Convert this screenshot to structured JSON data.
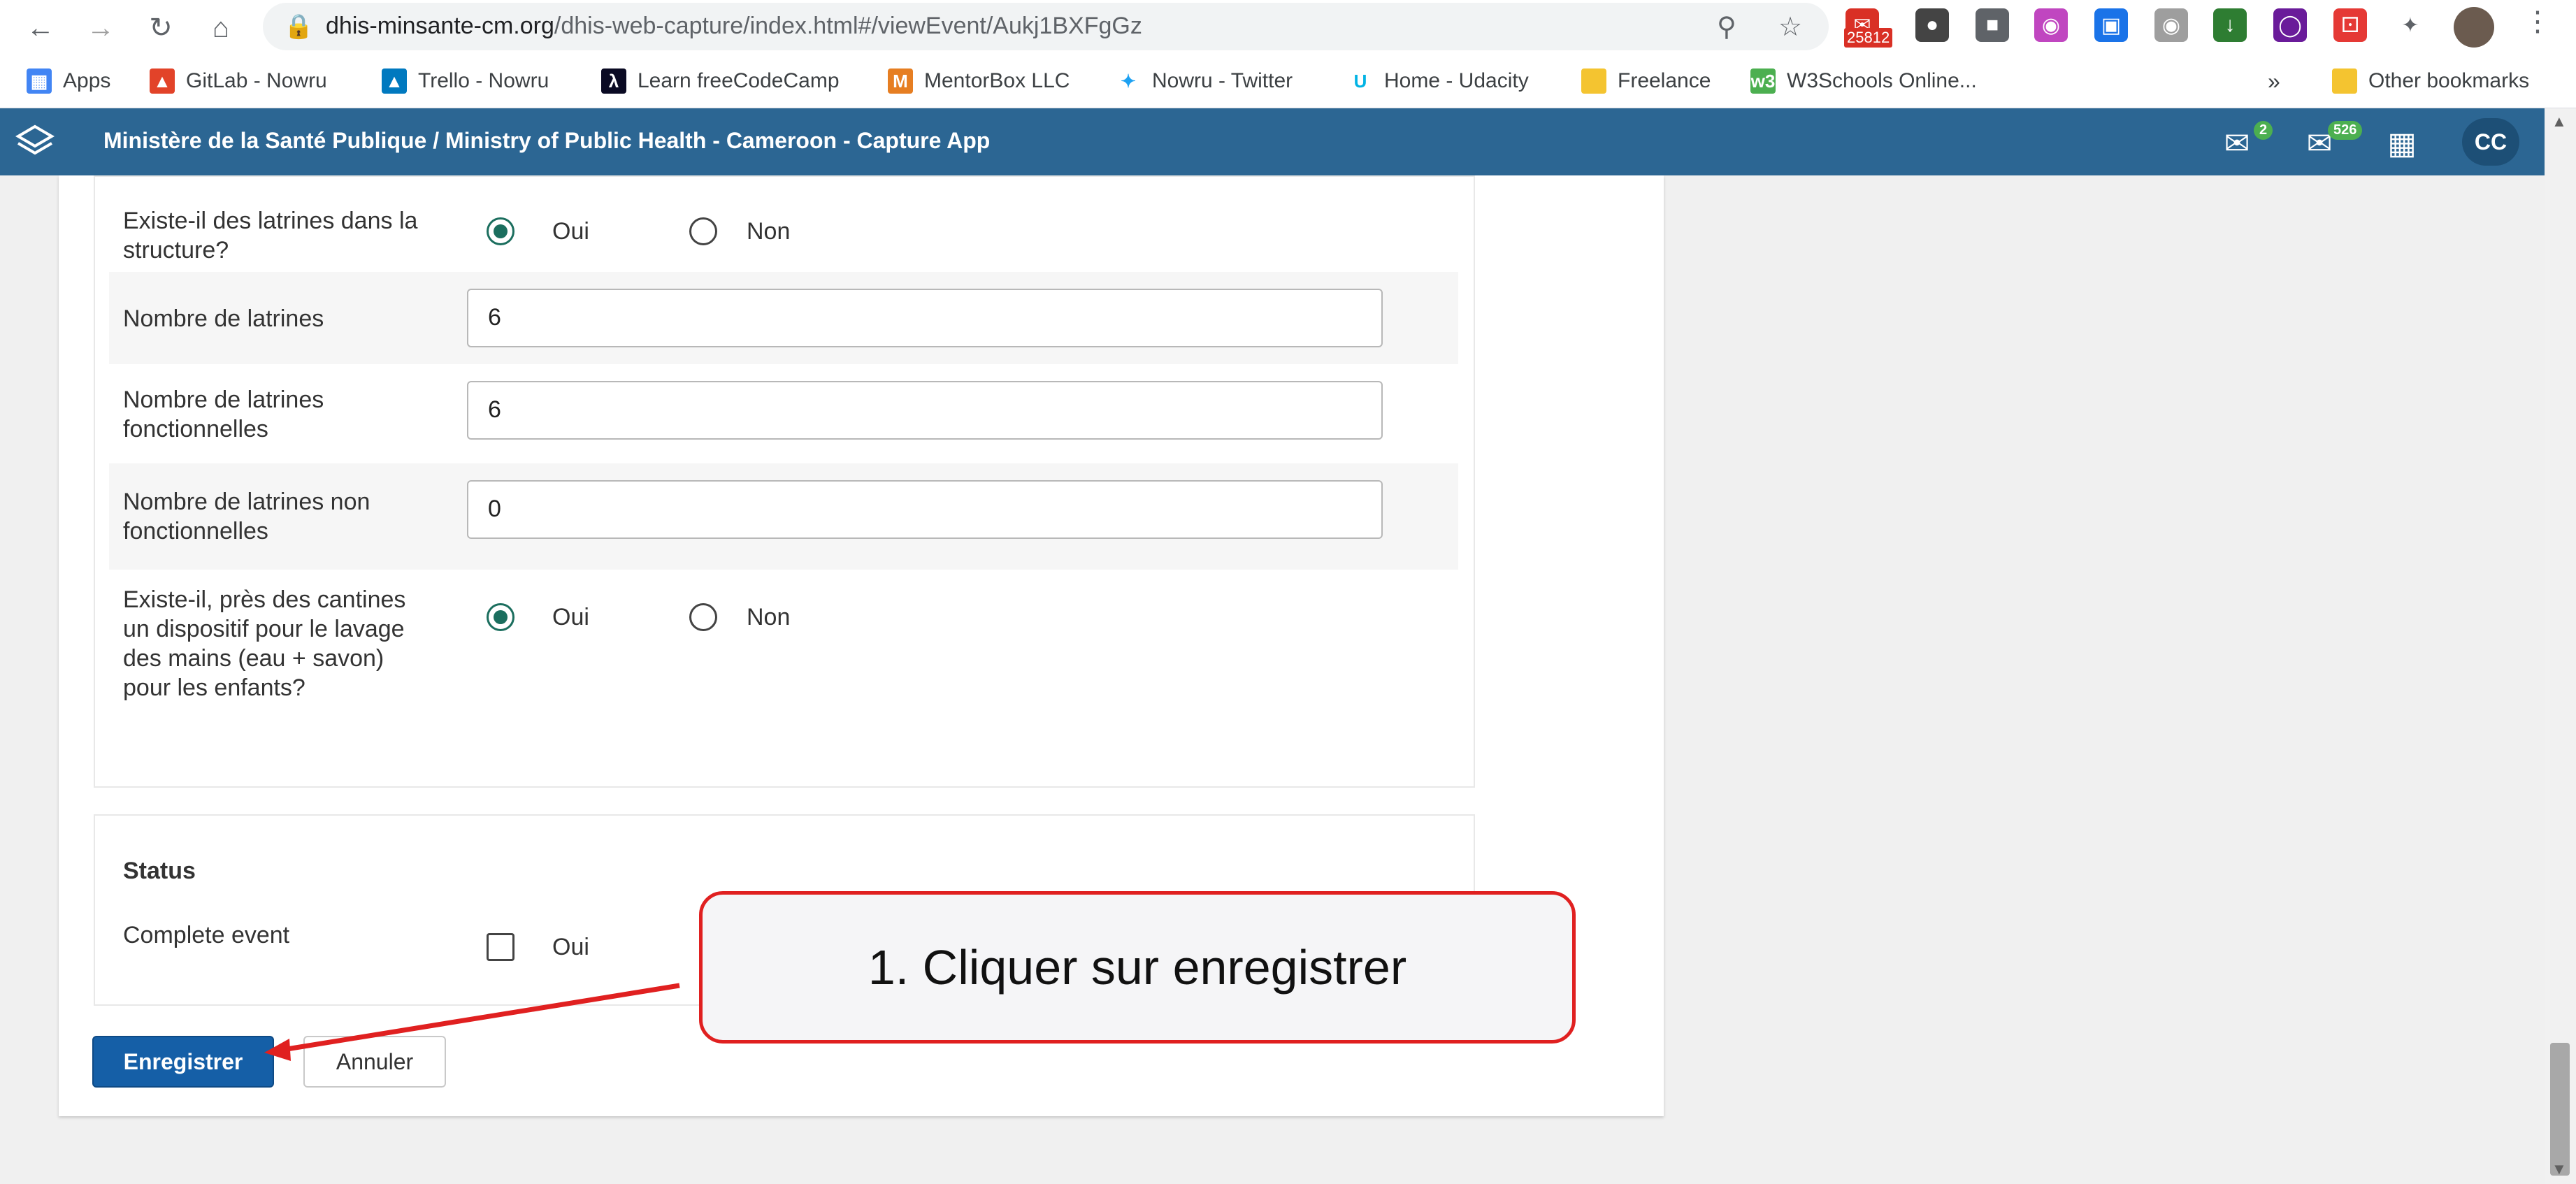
{
  "browser": {
    "url_domain": "dhis-minsante-cm.org",
    "url_path": "/dhis-web-capture/index.html#/viewEvent/Aukj1BXFgGz",
    "extension_badge": "25812",
    "bookmarks": [
      {
        "label": "Apps",
        "icon": "apps-grid-icon",
        "color": "#4285f4"
      },
      {
        "label": "GitLab - Nowru",
        "icon": "gitlab-icon",
        "color": "#e24329"
      },
      {
        "label": "Trello - Nowru",
        "icon": "trello-icon",
        "color": "#0079bf"
      },
      {
        "label": "Learn freeCodeCamp",
        "icon": "freecodecamp-icon",
        "color": "#0a0a23"
      },
      {
        "label": "MentorBox LLC",
        "icon": "mentorbox-icon",
        "color": "#e67e22"
      },
      {
        "label": "Nowru - Twitter",
        "icon": "twitter-icon",
        "color": "#1da1f2"
      },
      {
        "label": "Home - Udacity",
        "icon": "udacity-icon",
        "color": "#02b3e4"
      },
      {
        "label": "Freelance",
        "icon": "folder-icon",
        "color": "#f4c430"
      },
      {
        "label": "W3Schools Online...",
        "icon": "w3schools-icon",
        "color": "#4caf50"
      }
    ],
    "other_bookmarks": "Other bookmarks"
  },
  "app": {
    "title": "Ministère de la Santé Publique / Ministry of Public Health - Cameroon - Capture App",
    "messages_count": "2",
    "mail_count": "526",
    "user_initials": "CC",
    "header_color": "#2c6693"
  },
  "form": {
    "q_latrines": {
      "label": "Existe-il des latrines dans la structure?",
      "yes": "Oui",
      "no": "Non",
      "selected": "Oui"
    },
    "nb_latrines": {
      "label": "Nombre de latrines",
      "value": "6"
    },
    "nb_fonctionnelles": {
      "label": "Nombre de latrines fonctionnelles",
      "value": "6"
    },
    "nb_non_fonctionnelles": {
      "label": "Nombre de latrines non fonctionnelles",
      "value": "0"
    },
    "q_lavage": {
      "label": "Existe-il, près des cantines un dispositif pour le lavage des mains (eau + savon) pour les enfants?",
      "yes": "Oui",
      "no": "Non",
      "selected": "Oui"
    }
  },
  "status": {
    "title": "Status",
    "complete_label": "Complete event",
    "complete_option": "Oui",
    "complete_checked": false
  },
  "actions": {
    "save": "Enregistrer",
    "cancel": "Annuler"
  },
  "callout": {
    "text": "1. Cliquer sur enregistrer",
    "color": "#e02020"
  }
}
